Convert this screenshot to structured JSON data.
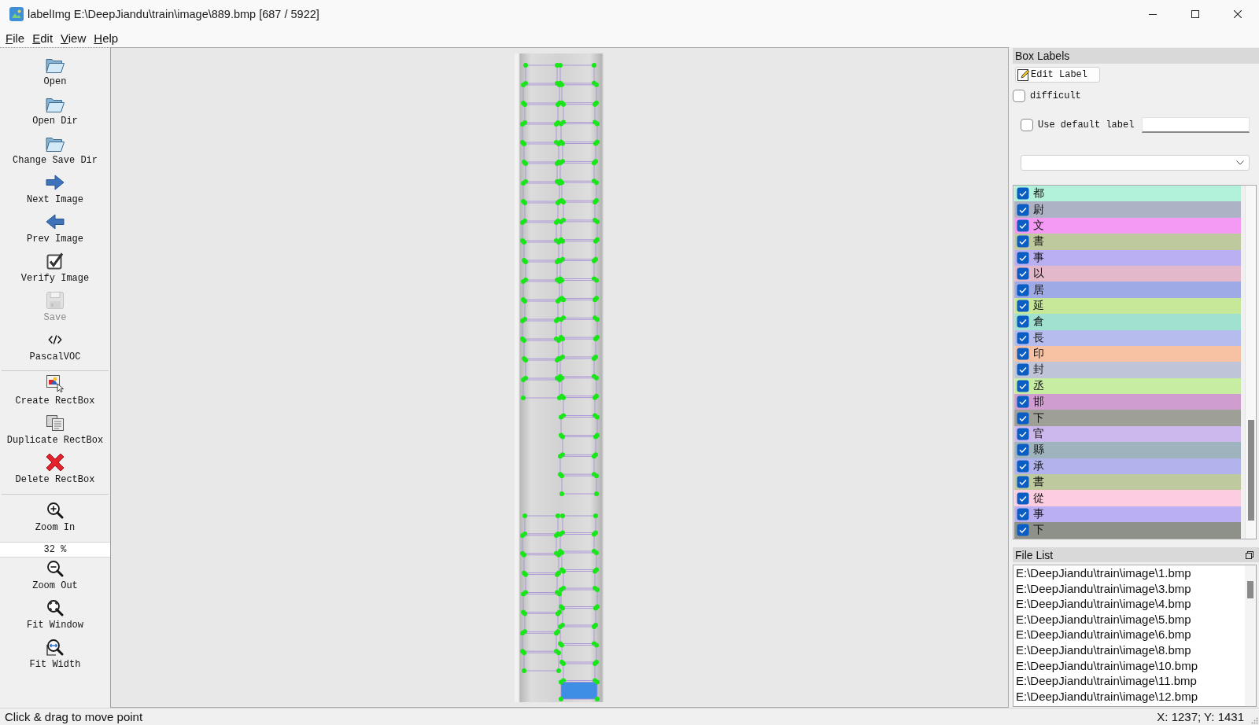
{
  "window": {
    "title": "labelImg E:\\DeepJiandu\\train\\image\\889.bmp [687 / 5922]"
  },
  "menu": [
    "File",
    "Edit",
    "View",
    "Help"
  ],
  "toolbar": {
    "groups": [
      {
        "items": [
          {
            "kind": "button",
            "label": "Open",
            "disabled": false
          },
          {
            "kind": "button",
            "label": "Open Dir",
            "disabled": false
          },
          {
            "kind": "button",
            "label": "Change Save Dir",
            "disabled": false
          },
          {
            "kind": "button",
            "label": "Next Image",
            "disabled": false
          },
          {
            "kind": "button",
            "label": "Prev Image",
            "disabled": false
          },
          {
            "kind": "button",
            "label": "Verify Image",
            "disabled": false
          },
          {
            "kind": "button",
            "label": "Save",
            "disabled": true
          },
          {
            "kind": "button",
            "label": "PascalVOC",
            "disabled": false
          }
        ]
      },
      {
        "items": [
          {
            "kind": "button",
            "label": "Create RectBox",
            "disabled": false
          },
          {
            "kind": "button",
            "label": "Duplicate RectBox",
            "disabled": false
          },
          {
            "kind": "button",
            "label": "Delete RectBox",
            "disabled": false
          }
        ]
      },
      {
        "items": [
          {
            "kind": "button",
            "label": "Zoom In",
            "disabled": false
          },
          {
            "kind": "field",
            "value": "32 %"
          },
          {
            "kind": "button",
            "label": "Zoom Out",
            "disabled": false
          },
          {
            "kind": "button",
            "label": "Fit Window",
            "disabled": false
          },
          {
            "kind": "button",
            "label": "Fit Width",
            "disabled": false
          }
        ]
      }
    ]
  },
  "canvas": {
    "boxes": [
      {
        "selected": false
      },
      {
        "selected": false
      },
      {
        "selected": false
      },
      {
        "selected": false
      },
      {
        "selected": false
      },
      {
        "selected": false
      },
      {
        "selected": false
      },
      {
        "selected": false
      },
      {
        "selected": false
      },
      {
        "selected": false
      },
      {
        "selected": false
      },
      {
        "selected": false
      },
      {
        "selected": false
      },
      {
        "selected": false
      },
      {
        "selected": false
      },
      {
        "selected": false
      },
      {
        "selected": false
      },
      {
        "selected": false
      },
      {
        "selected": false
      },
      {
        "selected": false
      },
      {
        "selected": false
      },
      {
        "selected": false
      },
      {
        "selected": false
      },
      {
        "selected": false
      },
      {
        "selected": false
      },
      {
        "selected": false
      },
      {
        "selected": false
      },
      {
        "selected": false
      },
      {
        "selected": false
      },
      {
        "selected": false
      },
      {
        "selected": false
      },
      {
        "selected": false
      },
      {
        "selected": false
      },
      {
        "selected": false
      },
      {
        "selected": false
      },
      {
        "selected": false
      },
      {
        "selected": false
      },
      {
        "selected": false
      },
      {
        "selected": false
      },
      {
        "selected": false
      },
      {
        "selected": false
      },
      {
        "selected": false
      },
      {
        "selected": false
      },
      {
        "selected": false
      },
      {
        "selected": false
      },
      {
        "selected": false
      },
      {
        "selected": false
      },
      {
        "selected": false
      },
      {
        "selected": true
      },
      {
        "selected": false
      },
      {
        "selected": false
      },
      {
        "selected": false
      },
      {
        "selected": false
      },
      {
        "selected": false
      },
      {
        "selected": false
      },
      {
        "selected": false
      },
      {
        "selected": false
      }
    ]
  },
  "box_labels": {
    "title": "Box Labels",
    "edit_button": "Edit Label",
    "difficult": {
      "label": "difficult",
      "checked": false
    },
    "default_label": {
      "label": "Use default label",
      "checked": false
    },
    "items": [
      {
        "label": "都",
        "checked": true,
        "color": "#b2f2da"
      },
      {
        "label": "尉",
        "checked": true,
        "color": "#adb3c4"
      },
      {
        "label": "文",
        "checked": true,
        "color": "#f49af4"
      },
      {
        "label": "書",
        "checked": true,
        "color": "#bfc99e"
      },
      {
        "label": "事",
        "checked": true,
        "color": "#baaff0"
      },
      {
        "label": "以",
        "checked": true,
        "color": "#e4b8cb"
      },
      {
        "label": "居",
        "checked": true,
        "color": "#9eaae6"
      },
      {
        "label": "延",
        "checked": true,
        "color": "#c7e799"
      },
      {
        "label": "倉",
        "checked": true,
        "color": "#a1e1d0"
      },
      {
        "label": "長",
        "checked": true,
        "color": "#b6bdee"
      },
      {
        "label": "印",
        "checked": true,
        "color": "#f7c1a3"
      },
      {
        "label": "封",
        "checked": true,
        "color": "#bfc4d8"
      },
      {
        "label": "丞",
        "checked": true,
        "color": "#c6eda1"
      },
      {
        "label": "邯",
        "checked": true,
        "color": "#cf9dcf"
      },
      {
        "label": "下",
        "checked": true,
        "color": "#9ea097"
      },
      {
        "label": "官",
        "checked": true,
        "color": "#cdb8ee"
      },
      {
        "label": "縣",
        "checked": true,
        "color": "#9fb3be"
      },
      {
        "label": "承",
        "checked": true,
        "color": "#b2b2ec"
      },
      {
        "label": "書",
        "checked": true,
        "color": "#bec99e"
      },
      {
        "label": "從",
        "checked": true,
        "color": "#fccce0"
      },
      {
        "label": "事",
        "checked": true,
        "color": "#baaff0"
      },
      {
        "label": "下",
        "checked": true,
        "color": "#8e918a"
      }
    ]
  },
  "file_list": {
    "title": "File List",
    "items": [
      "E:\\DeepJiandu\\train\\image\\1.bmp",
      "E:\\DeepJiandu\\train\\image\\3.bmp",
      "E:\\DeepJiandu\\train\\image\\4.bmp",
      "E:\\DeepJiandu\\train\\image\\5.bmp",
      "E:\\DeepJiandu\\train\\image\\6.bmp",
      "E:\\DeepJiandu\\train\\image\\8.bmp",
      "E:\\DeepJiandu\\train\\image\\10.bmp",
      "E:\\DeepJiandu\\train\\image\\11.bmp",
      "E:\\DeepJiandu\\train\\image\\12.bmp"
    ]
  },
  "status_bar": {
    "message": "Click & drag to move point",
    "position": "X: 1237; Y: 1431"
  }
}
